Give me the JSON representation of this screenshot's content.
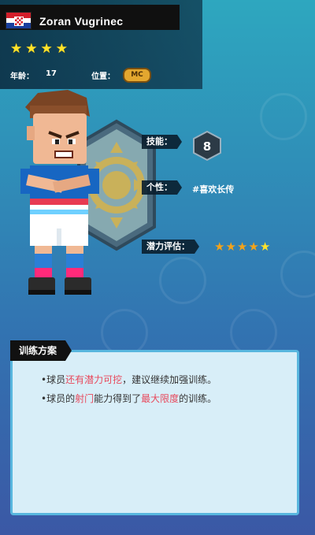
{
  "player": {
    "name": "Zoran Vugrinec",
    "flag_colors": [
      "#d41f2a",
      "#ffffff",
      "#1a3f9e"
    ],
    "stars": 4,
    "age_label": "年龄：",
    "age_value": "17",
    "position_label": "位置：",
    "position_value": "MC"
  },
  "attributes": {
    "skill_label": "技能：",
    "skill_value": "8",
    "personality_label": "个性：",
    "personality_value": "#喜欢长传",
    "potential_label": "潜力评估：",
    "potential_stars": 5
  },
  "training": {
    "title": "训练方案",
    "line1": [
      "•球员",
      "还有潜力可挖",
      "，建议继续加强训练。"
    ],
    "line2": [
      "•球员的",
      "射门",
      "能力得到了",
      "最大限度",
      "的训练。"
    ]
  },
  "colors": {
    "star_yellow": "#ffe32a",
    "star_orange": "#f2a31b",
    "highlight_red": "#e8495c",
    "panel_bg": "#d8eef8",
    "panel_border": "#58b6de"
  }
}
